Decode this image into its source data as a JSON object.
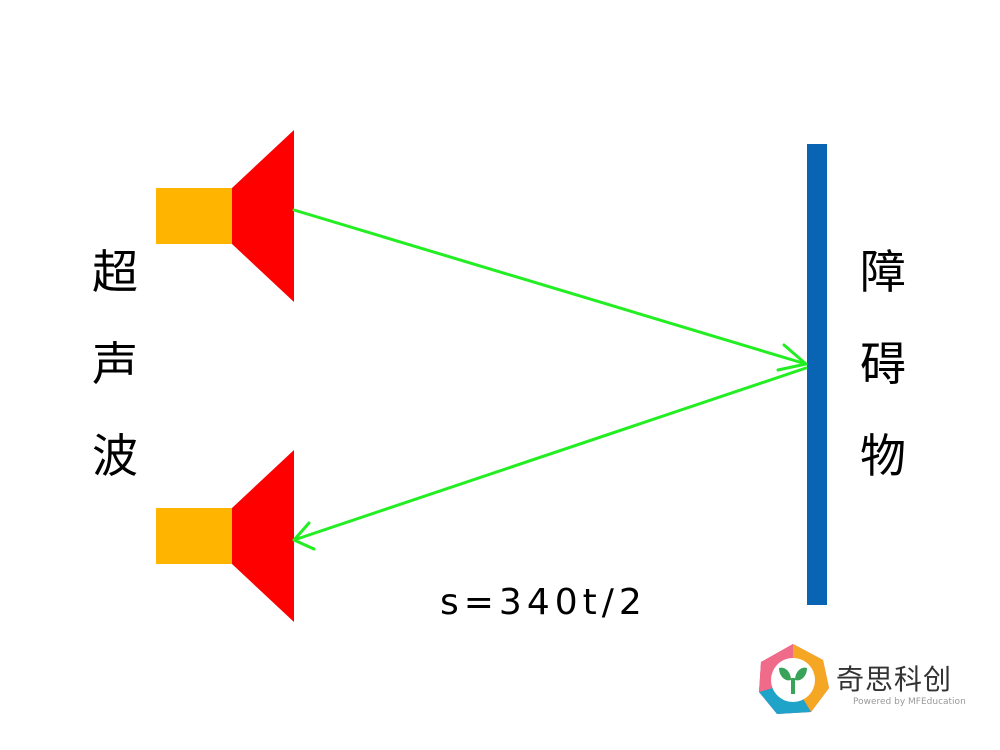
{
  "labels": {
    "left": [
      "超",
      "声",
      "波"
    ],
    "right": [
      "障",
      "碍",
      "物"
    ]
  },
  "formula": "s=340t/2",
  "logo": {
    "title": "奇思科创",
    "subtitle": "Powered by MFEducation"
  },
  "colors": {
    "speaker_body": "#FFB400",
    "speaker_cone": "#FF0000",
    "wave": "#22EE22",
    "obstacle": "#0A64B4"
  },
  "icons": {
    "speaker": "speaker-icon",
    "logo": "brand-logo-icon"
  }
}
